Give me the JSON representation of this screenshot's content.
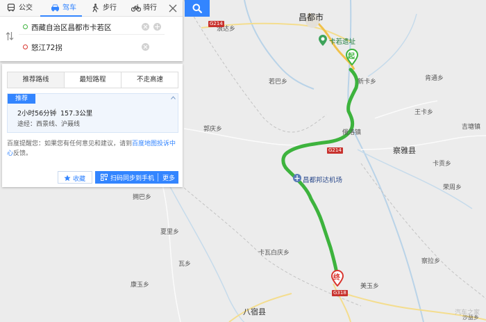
{
  "nav": {
    "modes": [
      {
        "label": "公交",
        "icon": "bus-icon"
      },
      {
        "label": "驾车",
        "icon": "car-icon"
      },
      {
        "label": "步行",
        "icon": "walk-icon"
      },
      {
        "label": "骑行",
        "icon": "bike-icon"
      }
    ],
    "active_mode": "驾车",
    "close_icon": "close-icon",
    "search_icon": "search-icon"
  },
  "waypoints": {
    "start": "西藏自治区昌都市卡若区",
    "end": "怒江72拐"
  },
  "result": {
    "strategies": [
      "推荐路线",
      "最短路程",
      "不走高速"
    ],
    "selected_strategy": "推荐路线",
    "plan": {
      "badge": "推荐",
      "time": "2小时56分钟",
      "distance": "157.3公里",
      "via": "途经：西景线、沪聂线"
    },
    "tip_prefix": "百度提醒您：如果您有任何意见和建议，请到",
    "tip_link": "百度地图投诉中心",
    "tip_suffix": "反馈。",
    "favorite_label": "收藏",
    "send_to_phone_label": "扫码同步到手机",
    "more_label": "更多"
  },
  "map": {
    "city": "昌都市",
    "county": "察雅县",
    "county_south": "八宿县",
    "poi_site": "卡若遗址",
    "airport": "昌都邦达机场",
    "start_marker": "起",
    "end_marker": "终",
    "towns": [
      "浪达乡",
      "若巴乡",
      "俄洛镇",
      "新卡乡",
      "肯通乡",
      "王卡乡",
      "吉塘镇",
      "卡贡乡",
      "荣周乡",
      "察拉乡",
      "郭庆乡",
      "拥巴乡",
      "夏里乡",
      "卡瓦白庆乡",
      "瓦乡",
      "康玉乡",
      "美玉乡",
      "沙益乡"
    ],
    "roads": [
      "G214",
      "G214",
      "G318"
    ],
    "watermark": "汽车之家",
    "route_color": "#3db33d",
    "accent_color": "#3385ff"
  }
}
